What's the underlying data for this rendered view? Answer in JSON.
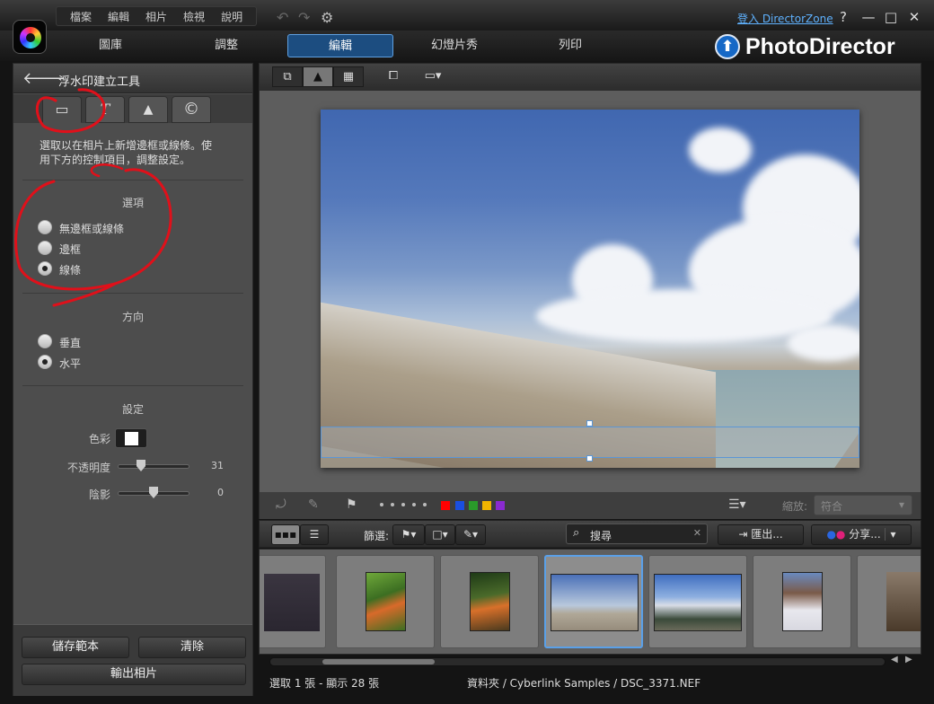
{
  "menu": [
    "檔案",
    "編輯",
    "相片",
    "檢視",
    "說明"
  ],
  "login_link": "登入 DirectorZone",
  "window_buttons": {
    "help": "?",
    "minimize": "—",
    "maximize": "□",
    "close": "✕"
  },
  "modes": [
    "圖庫",
    "調整",
    "編輯",
    "幻燈片秀",
    "列印"
  ],
  "active_mode": "編輯",
  "brand": {
    "name": "PhotoDirector",
    "icon": "up-arrow-logo"
  },
  "panel": {
    "title": "浮水印建立工具",
    "tabs": [
      {
        "name": "border-line",
        "glyph": "▭"
      },
      {
        "name": "text",
        "glyph": "T"
      },
      {
        "name": "image",
        "glyph": "🖼"
      },
      {
        "name": "copyright",
        "glyph": "©"
      }
    ],
    "description_line1": "選取以在相片上新增邊框或線條。使",
    "description_line2": "用下方的控制項目，調整設定。",
    "options_header": "選項",
    "options": [
      "無邊框或線條",
      "邊框",
      "線條"
    ],
    "options_selected": "線條",
    "direction_header": "方向",
    "directions": [
      "垂直",
      "水平"
    ],
    "direction_selected": "水平",
    "settings_header": "設定",
    "color_label": "色彩",
    "color_value": "#ffffff",
    "opacity_label": "不透明度",
    "opacity_value": "31",
    "shadow_label": "陰影",
    "shadow_value": "0",
    "save_template": "儲存範本",
    "clear": "清除",
    "export_photo": "輸出相片"
  },
  "viewer": {
    "zoom_label": "縮放:",
    "zoom_value": "符合",
    "color_labels": [
      "#ff0000",
      "#1a4fe0",
      "#2a9a2a",
      "#f0b400",
      "#8a2ad0"
    ]
  },
  "filmbar": {
    "filter_label": "篩選:",
    "search_placeholder": "搜尋",
    "export_label": "匯出...",
    "share_label": "分享..."
  },
  "status": {
    "selection": "選取 1 張 - 顯示 28 張",
    "path": "資料夾 / Cyberlink Samples / DSC_3371.NEF"
  }
}
